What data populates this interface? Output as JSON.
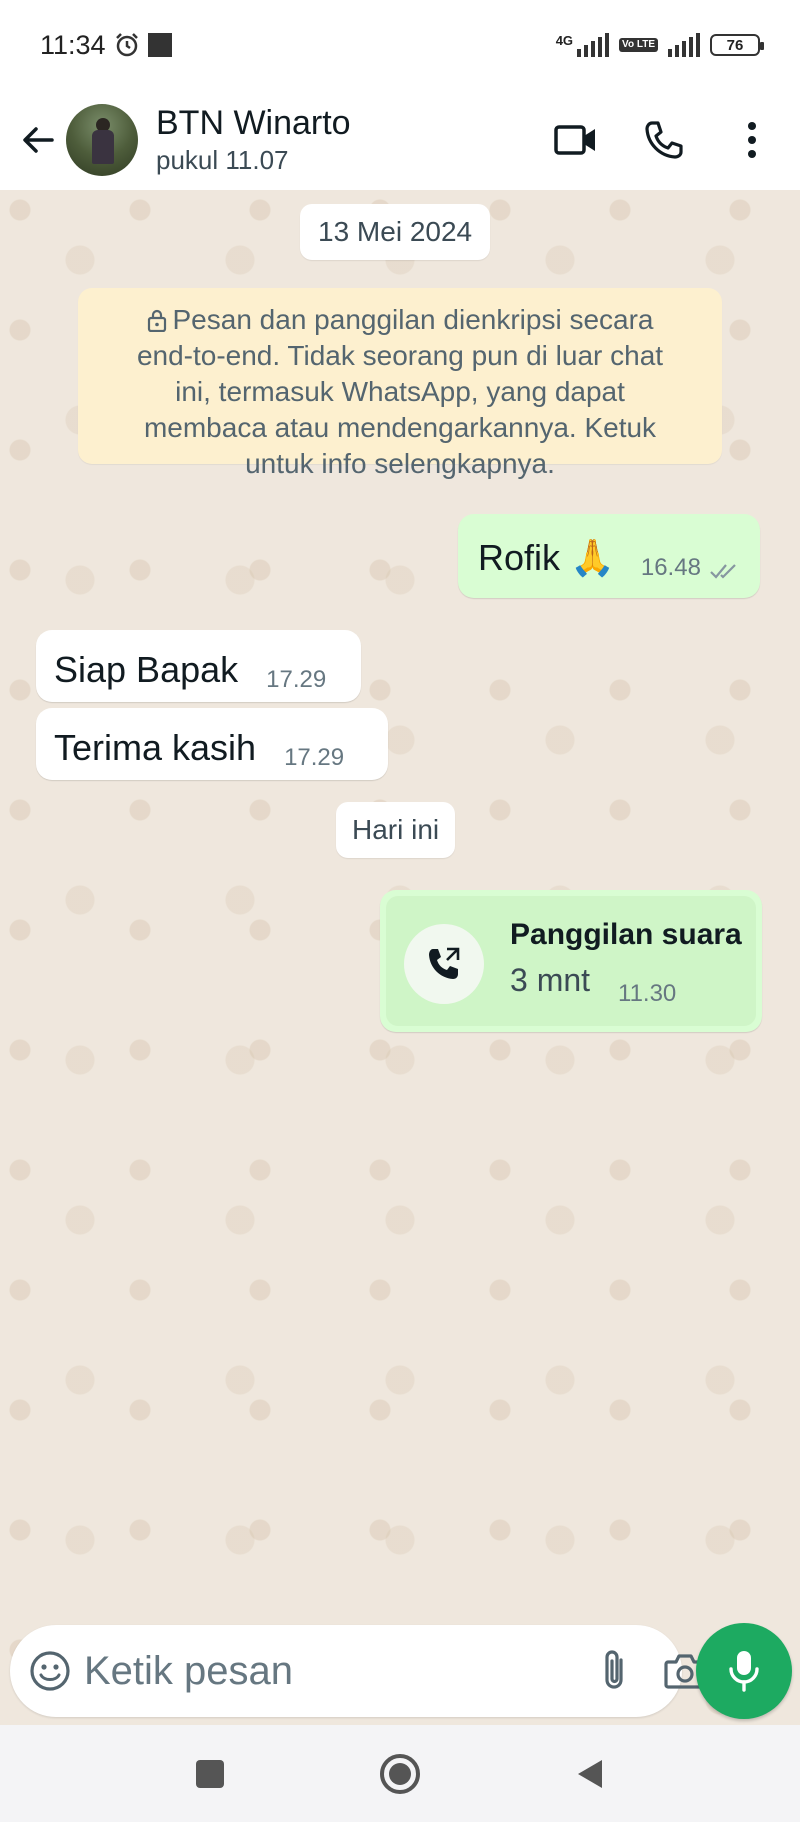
{
  "status_bar": {
    "time": "11:34",
    "network": "4G",
    "volte": "Vo LTE",
    "battery": "76"
  },
  "header": {
    "contact_name": "BTN Winarto",
    "last_seen": "pukul 11.07",
    "icons": [
      "back-arrow-icon",
      "video-call-icon",
      "voice-call-icon",
      "more-options-icon"
    ]
  },
  "chat": {
    "date_chip_1": "13 Mei 2024",
    "encryption_notice": "Pesan dan panggilan dienkripsi secara end-to-end. Tidak seorang pun di luar chat ini, termasuk WhatsApp, yang dapat membaca atau mendengarkannya. Ketuk untuk info selengkapnya.",
    "messages": [
      {
        "direction": "out",
        "text": "Rofik 🙏",
        "time": "16.48",
        "status": "read"
      },
      {
        "direction": "in",
        "text": "Siap Bapak",
        "time": "17.29"
      },
      {
        "direction": "in",
        "text": "Terima kasih",
        "time": "17.29"
      }
    ],
    "date_chip_2": "Hari ini",
    "call": {
      "title": "Panggilan suara",
      "duration": "3 mnt",
      "time": "11.30"
    }
  },
  "composer": {
    "placeholder": "Ketik pesan"
  },
  "colors": {
    "outgoing_bubble": "#d9fdd3",
    "incoming_bubble": "#ffffff",
    "encryption_bg": "#fdf0cf",
    "mic_button": "#1daa61",
    "chat_bg": "#efe7dd"
  }
}
